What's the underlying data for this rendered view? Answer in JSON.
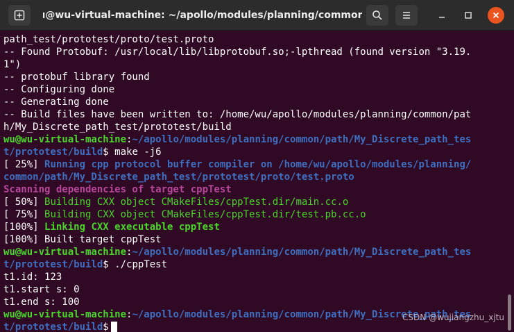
{
  "window": {
    "title": "wu@wu-virtual-machine: ~/apollo/modules/planning/common...",
    "new_tab_icon": "new-tab-icon",
    "search_icon": "search-icon",
    "menu_icon": "hamburger-menu-icon",
    "minimize_icon": "minimize-icon",
    "maximize_icon": "maximize-icon",
    "close_icon": "close-icon"
  },
  "colors": {
    "background": "#300a24",
    "prompt_user": "#4bd62b",
    "prompt_path": "#3f6fc0",
    "cmake_progress": "#3f6fc0",
    "cmake_scan": "#b8479b",
    "cmake_build": "#4bd62b",
    "close_button": "#e95420"
  },
  "terminal": {
    "l1": "path_test/prototest/proto/test.proto",
    "l2": "-- Found Protobuf: /usr/local/lib/libprotobuf.so;-lpthread (found version \"3.19.",
    "l3": "1\")",
    "l4": "-- protobuf library found",
    "l5": "-- Configuring done",
    "l6": "-- Generating done",
    "l7": "-- Build files have been written to: /home/wu/apollo/modules/planning/common/pat",
    "l8": "h/My_Discrete_path_test/prototest/build",
    "p1_user": "wu@wu-virtual-machine",
    "p1_path": "~/apollo/modules/planning/common/path/My_Discrete_path_tes",
    "p1_path_wrap": "t/prototest/build",
    "p1_dollar": "$",
    "p1_cmd": "make -j6",
    "l11_pct": "[ 25%]",
    "l11_msg": "Running cpp protocol buffer compiler on /home/wu/apollo/modules/planning/",
    "l12": "common/path/My_Discrete_path_test/prototest/proto/test.proto",
    "l13": "Scanning dependencies of target cppTest",
    "l14_pct": "[ 50%]",
    "l14_msg": "Building CXX object CMakeFiles/cppTest.dir/main.cc.o",
    "l15_pct": "[ 75%]",
    "l15_msg": "Building CXX object CMakeFiles/cppTest.dir/test.pb.cc.o",
    "l16_pct": "[100%]",
    "l16_msg": "Linking CXX executable cppTest",
    "l17": "[100%] Built target cppTest",
    "p2_user": "wu@wu-virtual-machine",
    "p2_path": "~/apollo/modules/planning/common/path/My_Discrete_path_tes",
    "p2_path_wrap": "t/prototest/build",
    "p2_dollar": "$",
    "p2_cmd": "./cppTest",
    "o1": "t1.id: 123",
    "o2": "t1.start s: 0",
    "o3": "t1.end s: 100",
    "p3_user": "wu@wu-virtual-machine",
    "p3_path": "~/apollo/modules/planning/common/path/My_Discrete_path_tes",
    "p3_path_wrap": "t/prototest/build",
    "p3_dollar": "$"
  },
  "watermark": "CSDN @wujiangzhu_xjtu"
}
